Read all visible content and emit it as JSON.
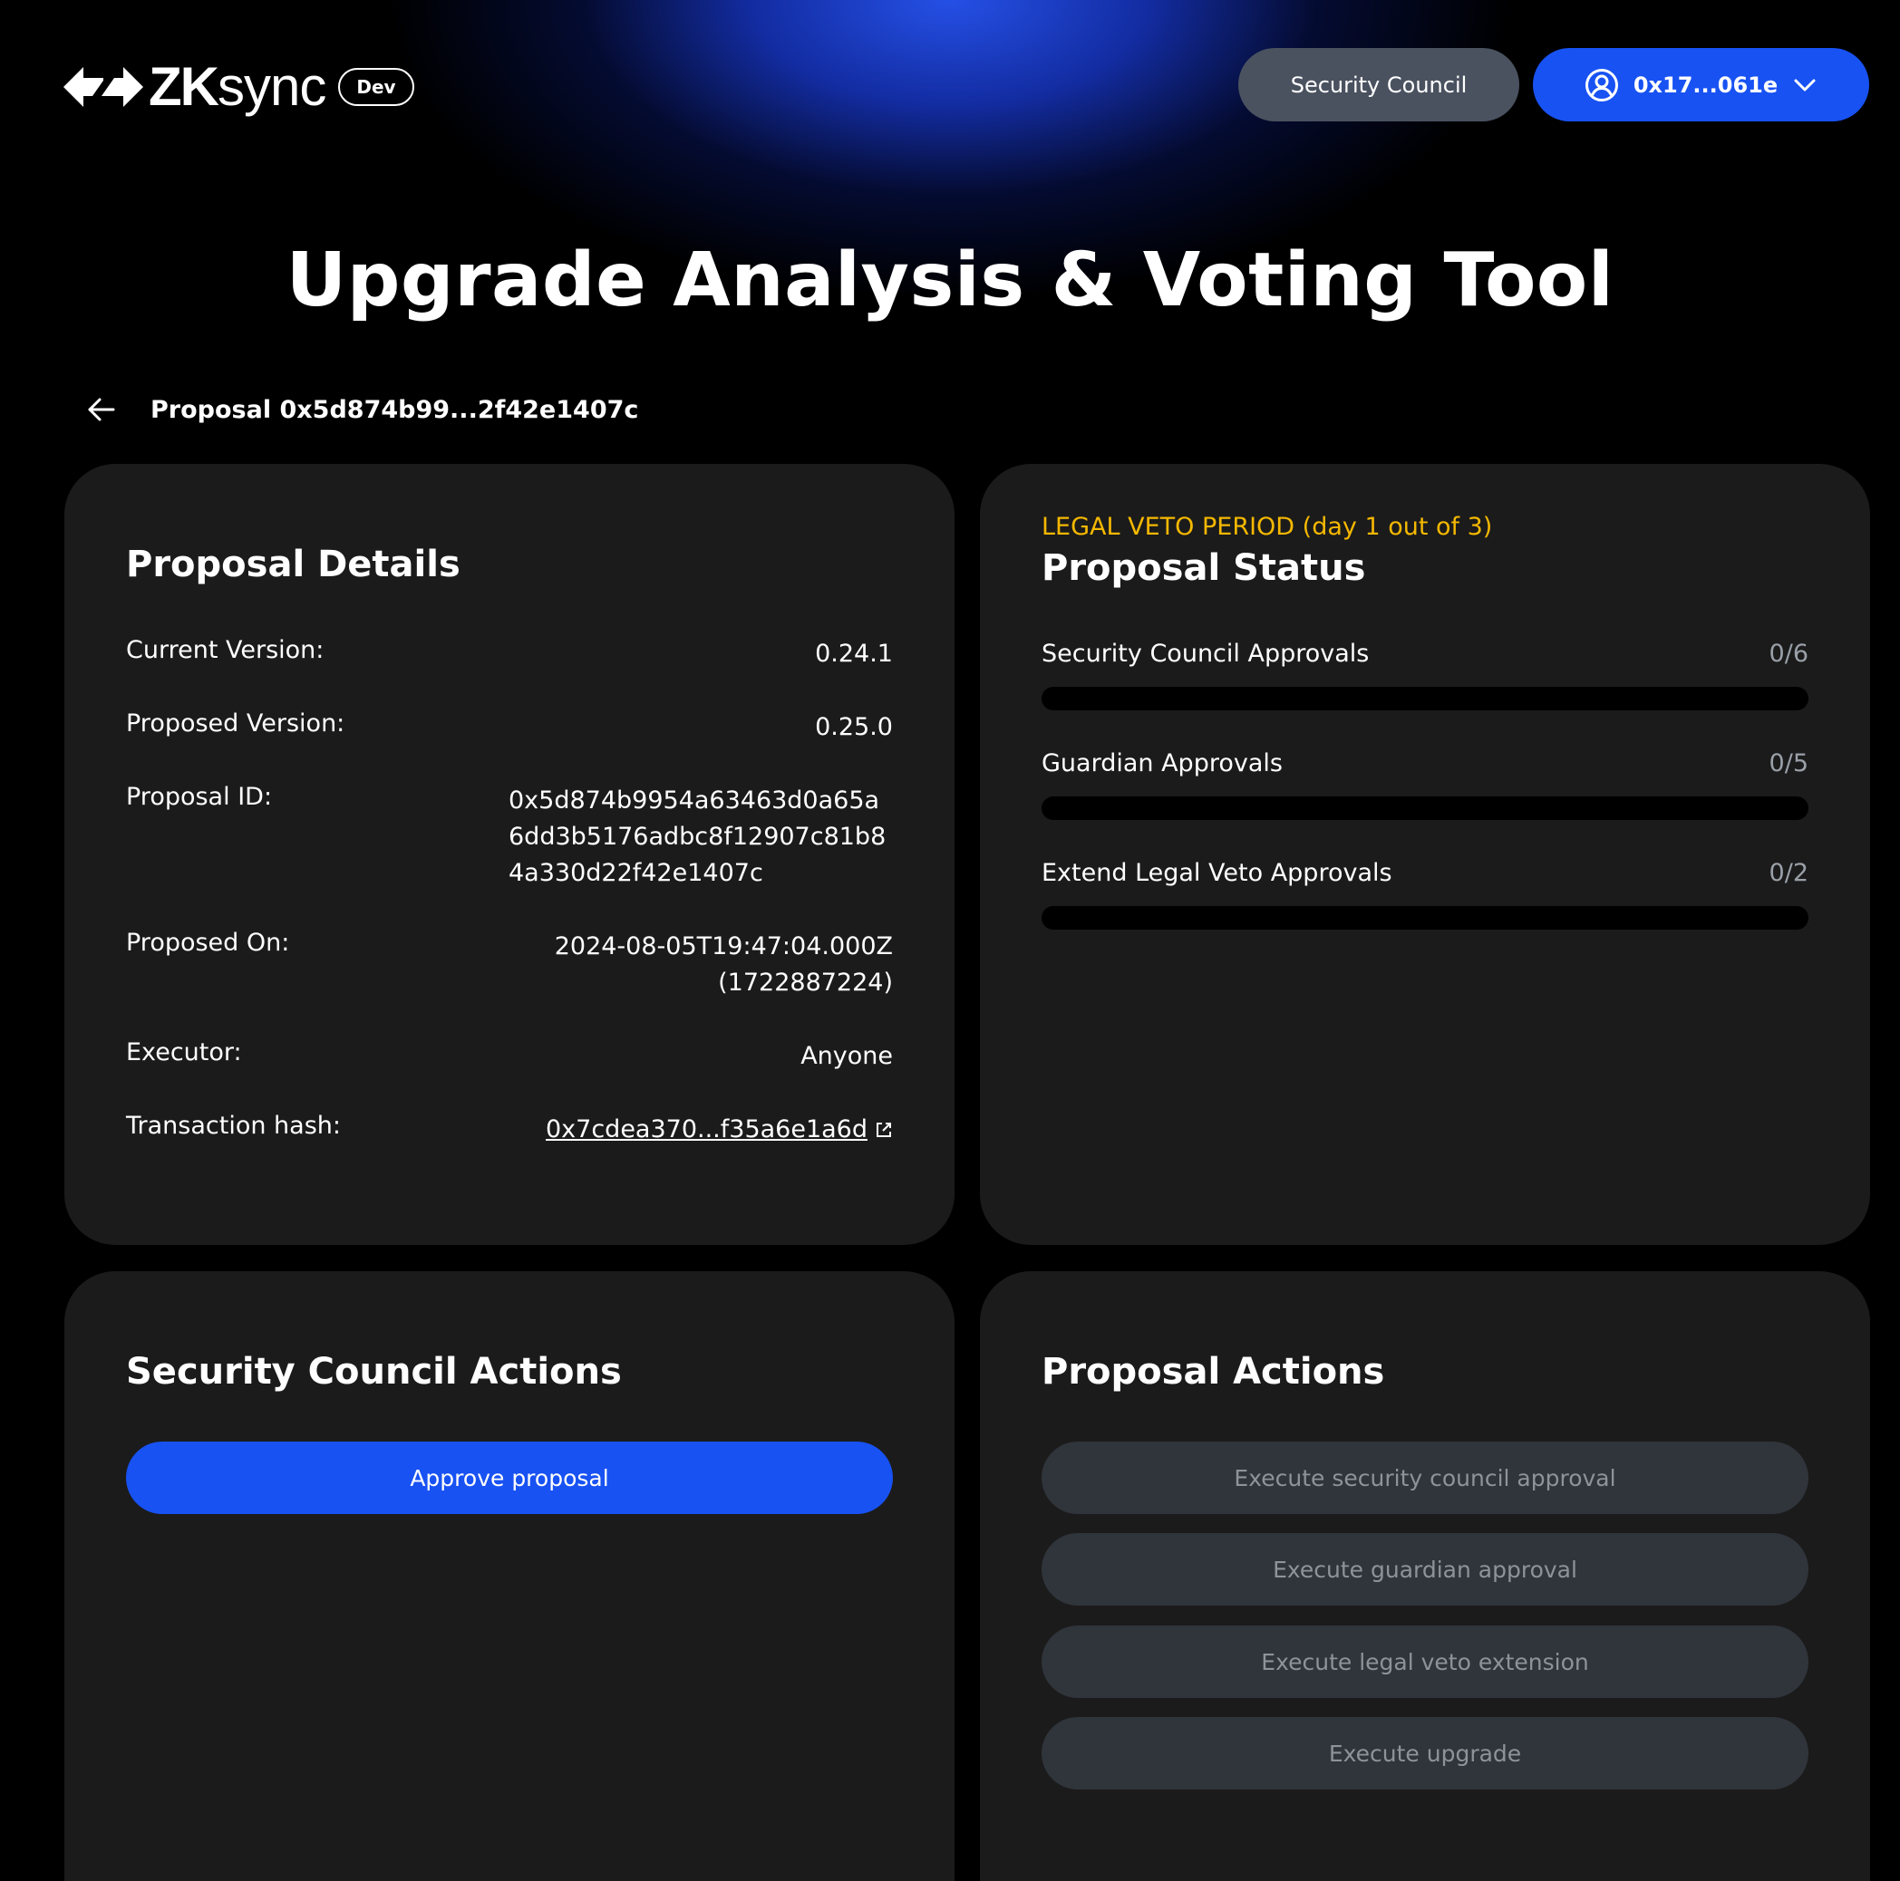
{
  "header": {
    "brand_zk": "ZK",
    "brand_sync": "sync",
    "env_badge": "Dev",
    "council_button": "Security Council",
    "wallet_address": "0x17...061e"
  },
  "title": "Upgrade Analysis & Voting Tool",
  "breadcrumb": "Proposal 0x5d874b99...2f42e1407c",
  "details": {
    "title": "Proposal Details",
    "rows": [
      {
        "label": "Current Version:",
        "value": "0.24.1"
      },
      {
        "label": "Proposed Version:",
        "value": "0.25.0"
      },
      {
        "label": "Proposal ID:",
        "value": "0x5d874b9954a63463d0a65a6dd3b5176adbc8f12907c81b84a330d22f42e1407c"
      },
      {
        "label": "Proposed On:",
        "value": "2024-08-05T19:47:04.000Z",
        "value2": "(1722887224)"
      },
      {
        "label": "Executor:",
        "value": "Anyone"
      },
      {
        "label": "Transaction hash:",
        "value": "0x7cdea370...f35a6e1a6d"
      }
    ]
  },
  "status": {
    "period": "LEGAL VETO PERIOD (day 1 out of 3)",
    "title": "Proposal Status",
    "items": [
      {
        "label": "Security Council Approvals",
        "count": "0/6",
        "progress": 0
      },
      {
        "label": "Guardian Approvals",
        "count": "0/5",
        "progress": 0
      },
      {
        "label": "Extend Legal Veto Approvals",
        "count": "0/2",
        "progress": 0
      }
    ]
  },
  "council_actions": {
    "title": "Security Council Actions",
    "approve_label": "Approve proposal"
  },
  "proposal_actions": {
    "title": "Proposal Actions",
    "buttons": [
      "Execute security council approval",
      "Execute guardian approval",
      "Execute legal veto extension",
      "Execute upgrade"
    ]
  },
  "colors": {
    "accent": "#1852f3",
    "warning": "#f5b800",
    "card_bg": "#1b1b1b"
  }
}
